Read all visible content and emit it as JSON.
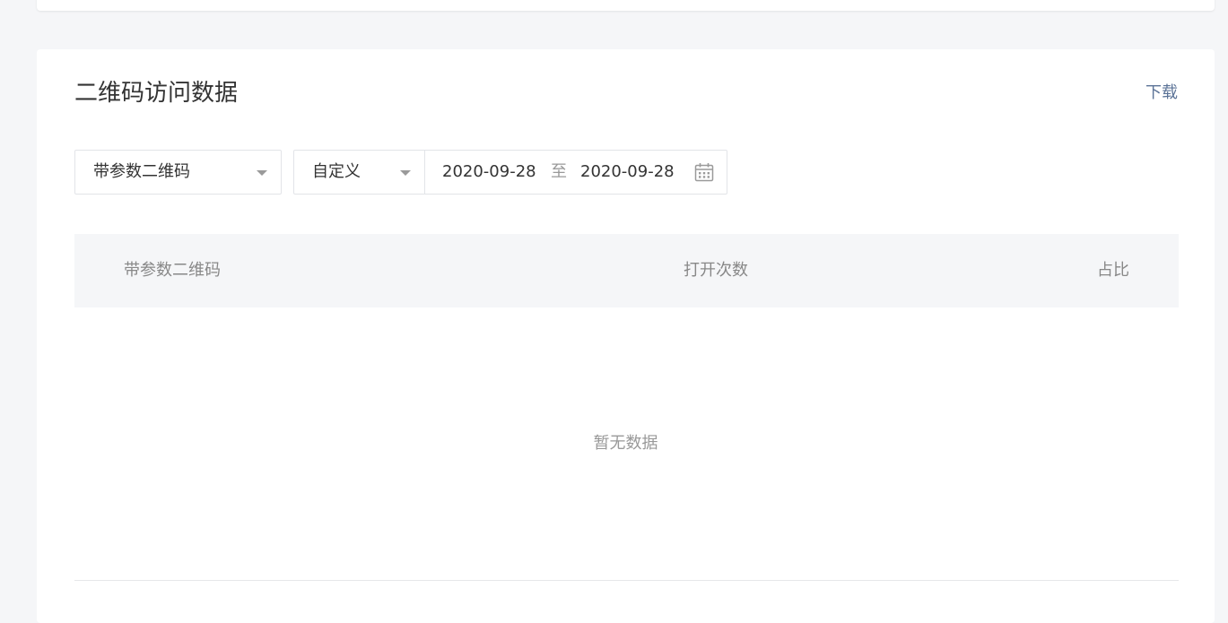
{
  "card": {
    "title": "二维码访问数据",
    "download_label": "下载"
  },
  "filters": {
    "qr_type": {
      "selected": "带参数二维码"
    },
    "range_type": {
      "selected": "自定义"
    },
    "date_range": {
      "start": "2020-09-28",
      "separator": "至",
      "end": "2020-09-28"
    }
  },
  "table": {
    "columns": [
      "带参数二维码",
      "打开次数",
      "占比"
    ],
    "rows": [],
    "empty_text": "暂无数据"
  },
  "icons": {
    "dropdown": "chevron-down-icon",
    "calendar": "calendar-icon"
  },
  "colors": {
    "link": "#5b7397",
    "background": "#f5f6f8",
    "header_bg": "#f5f6f8"
  }
}
